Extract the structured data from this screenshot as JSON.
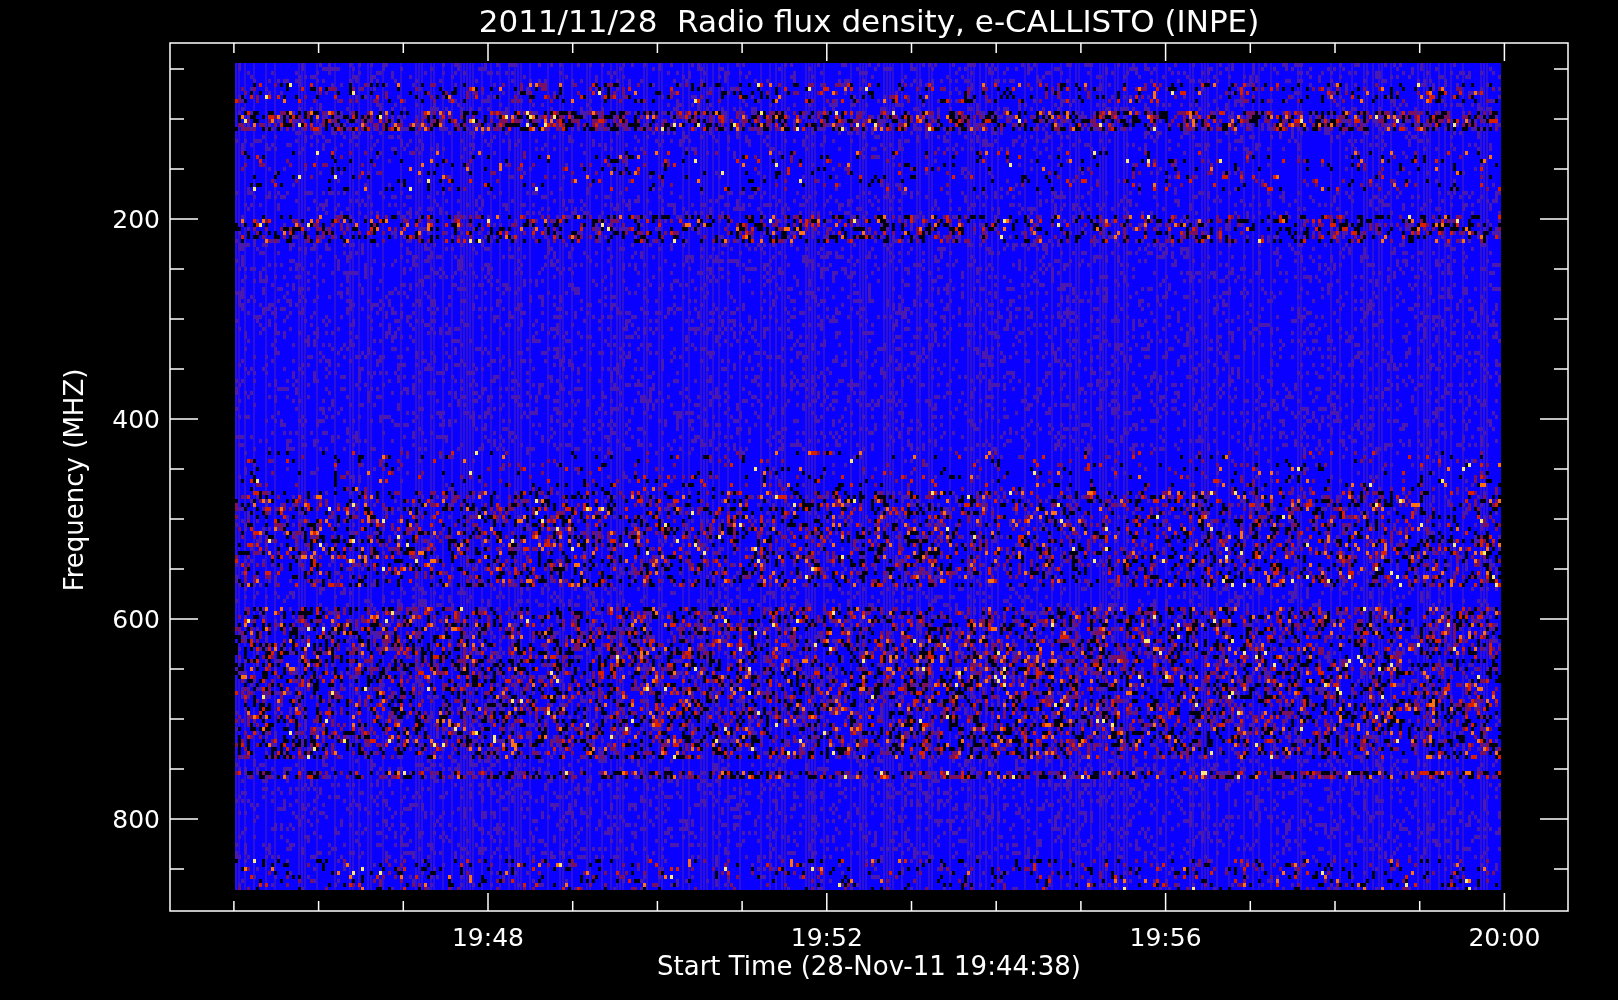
{
  "plot": {
    "title": "2011/11/28  Radio flux density, e-CALLISTO (INPE)",
    "xlabel": "Start Time (28-Nov-11 19:44:38)",
    "ylabel": "Frequency (MHZ)",
    "xticks": [
      {
        "label": "19:48"
      },
      {
        "label": "19:52"
      },
      {
        "label": "19:56"
      },
      {
        "label": "20:00"
      }
    ],
    "yticks": [
      {
        "label": "200"
      },
      {
        "label": "400"
      },
      {
        "label": "600"
      },
      {
        "label": "800"
      }
    ]
  }
}
